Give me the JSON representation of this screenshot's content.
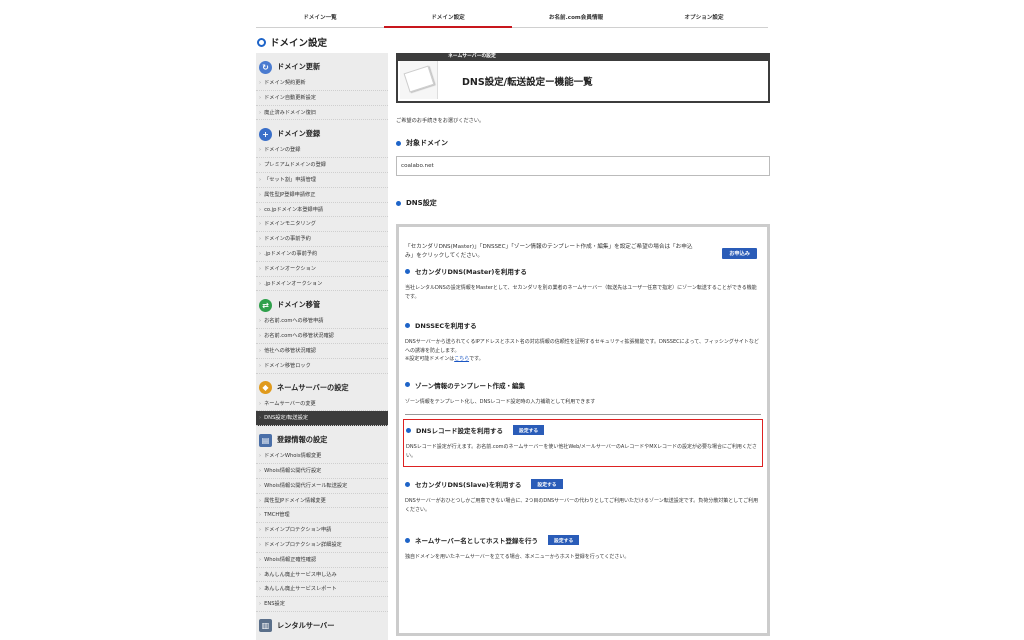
{
  "tabs": [
    {
      "label": "ドメイン一覧"
    },
    {
      "label": "ドメイン設定"
    },
    {
      "label": "お名前.com会員情報"
    },
    {
      "label": "オプション設定"
    }
  ],
  "page_title": "ドメイン設定",
  "sidebar": {
    "sections": [
      {
        "title": "ドメイン更新",
        "icon": "refresh-icon",
        "items": [
          "ドメイン契約更新",
          "ドメイン自動更新設定",
          "廃止済みドメイン復旧"
        ]
      },
      {
        "title": "ドメイン登録",
        "icon": "plus-icon",
        "items": [
          "ドメインの登録",
          "プレミアムドメインの登録",
          "「セット割」申請管理",
          "属性型JP登録申請修正",
          "co.jpドメイン本登録申請",
          "ドメインモニタリング",
          "ドメインの事前予約",
          ".jpドメインの事前予約",
          "ドメインオークション",
          ".jpドメインオークション"
        ]
      },
      {
        "title": "ドメイン移管",
        "icon": "transfer-icon",
        "items": [
          "お名前.comへの移管申請",
          "お名前.comへの移管状況確認",
          "他社への移管状況確認",
          "ドメイン移管ロック"
        ]
      },
      {
        "title": "ネームサーバーの設定",
        "icon": "nameserver-icon",
        "items": [
          "ネームサーバーの変更",
          "DNS設定/転送設定"
        ]
      },
      {
        "title": "登録情報の設定",
        "icon": "registration-icon",
        "items": [
          "ドメインWhois情報変更",
          "Whois情報公開代行設定",
          "Whois情報公開代行メール転送設定",
          "属性型JPドメイン情報変更",
          "TMCH管理",
          "ドメインプロテクション申請",
          "ドメインプロテクション詳細設定",
          "Whois情報正確性確認",
          "あんしん廃止サービス申し込み",
          "あんしん廃止サービスレポート",
          "ENS設定"
        ]
      },
      {
        "title": "レンタルサーバー",
        "icon": "server-icon",
        "items": []
      }
    ],
    "active_item": "DNS設定/転送設定"
  },
  "header": {
    "sub": "ネームサーバーの設定",
    "title": "DNS設定/転送設定ー機能一覧"
  },
  "lead": "ご希望のお手続きをお選びください。",
  "target_domain": {
    "label": "対象ドメイン",
    "value": "coalabo.net"
  },
  "dns": {
    "label": "DNS設定",
    "intro": "「セカンダリDNS(Master)」「DNSSEC」「ゾーン情報のテンプレート作成・編集」を設定ご希望の場合は「お申込み」をクリックしてください。",
    "apply_label": "お申込み",
    "options": {
      "master": {
        "title": "セカンダリDNS(Master)を利用する",
        "desc": "当社レンタルDNSの設定情報をMasterとして、セカンダリを別の業者のネームサーバー（転送先はユーザー任意で指定）にゾーン転送することができる機能です。"
      },
      "dnssec": {
        "title": "DNSSECを利用する",
        "desc": "DNSサーバーから送られてくるIPアドレスとホスト名の対応情報の信頼性を証明するセキュリティ拡張機能です。DNSSECによって、フィッシングサイトなどへの誘導を防止します。",
        "note_prefix": "※設定可能ドメインは",
        "note_link": "こちら",
        "note_suffix": "です。"
      },
      "zone": {
        "title": "ゾーン情報のテンプレート作成・編集",
        "desc": "ゾーン情報をテンプレート化し、DNSレコード設定時の入力補助として利用できます"
      },
      "record": {
        "title": "DNSレコード設定を利用する",
        "button": "設定する",
        "desc": "DNSレコード設定が行えます。お名前.comのネームサーバーを使い他社Web/メールサーバーのAレコードやMXレコードの設定が必要な場合にご利用ください。"
      },
      "slave": {
        "title": "セカンダリDNS(Slave)を利用する",
        "button": "設定する",
        "desc": "DNSサーバーがおひとつしかご用意できない場合に、2つ目のDNSサーバーの代わりとしてご利用いただけるゾーン転送設定です。負荷分散対策としてご利用ください。"
      },
      "host": {
        "title": "ネームサーバー名としてホスト登録を行う",
        "button": "設定する",
        "desc": "独自ドメインを用いたネームサーバーを立てる場合、本メニューからホスト登録を行ってください。"
      }
    }
  },
  "colors": {
    "accent_blue": "#1e64c8",
    "button_blue": "#2a5cb8",
    "highlight_red": "#dd2222",
    "dark": "#3c3c3c"
  }
}
